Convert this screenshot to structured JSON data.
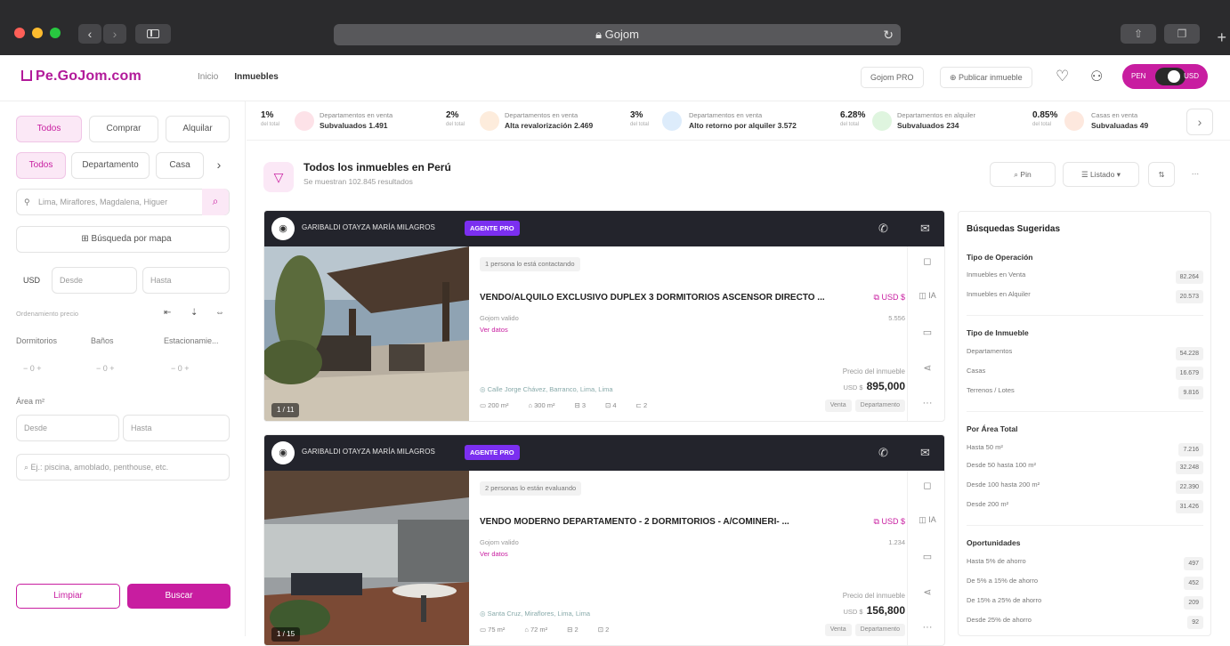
{
  "browser": {
    "url_text": "Gojom",
    "colors": {
      "close": "#ff5f57",
      "minimize": "#febc2e",
      "zoom": "#28c840"
    }
  },
  "header": {
    "logo": "Pe.GoJom.com",
    "nav": [
      "Inicio",
      "Inmuebles"
    ],
    "btn_pro": "Gojom PRO",
    "btn_publish": "Publicar inmueble",
    "toggle_left": "PEN",
    "toggle_right": "USD"
  },
  "sidebar": {
    "ops": [
      "Todos",
      "Comprar",
      "Alquilar"
    ],
    "types": [
      "Todos",
      "Departamento",
      "Casa"
    ],
    "location_placeholder": "Lima, Miraflores, Magdalena, Higuer",
    "map_search": "Búsqueda por mapa",
    "currency": "USD",
    "price_from": "Desde",
    "price_to": "Hasta",
    "order_label": "Ordenamiento precio",
    "rooms": [
      "Dormitorios",
      "Baños",
      "Estacionamie..."
    ],
    "area_label": "Área m²",
    "area_from": "Desde",
    "area_to": "Hasta",
    "keywords_placeholder": "Ej.: piscina, amoblado, penthouse, etc.",
    "clear_btn": "Limpiar",
    "search_btn": "Buscar"
  },
  "stats": [
    {
      "pct": "1%",
      "sub": "del total",
      "line1": "Departamentos en venta",
      "line2": "Subvaluados 1.491",
      "color": "#fde2e8"
    },
    {
      "pct": "2%",
      "sub": "del total",
      "line1": "Departamentos en venta",
      "line2": "Alta revalorización 2.469",
      "color": "#fdecdc"
    },
    {
      "pct": "3%",
      "sub": "del total",
      "line1": "Departamentos en venta",
      "line2": "Alto retorno por alquiler 3.572",
      "color": "#ddecfb"
    },
    {
      "pct": "6.28%",
      "sub": "del total",
      "line1": "Departamentos en alquiler",
      "line2": "Subvaluados 234",
      "color": "#dff5df"
    },
    {
      "pct": "0.85%",
      "sub": "del total",
      "line1": "Casas en venta",
      "line2": "Subvaluadas 49",
      "color": "#fde8de"
    }
  ],
  "results": {
    "title": "Todos los inmuebles en Perú",
    "subtitle": "Se muestran 102.845 resultados",
    "pin_btn": "Pin",
    "list_btn": "Listado"
  },
  "cards": [
    {
      "agent": "GARIBALDI OTAYZA MARÍA MILAGROS",
      "pro": "AGENTE PRO",
      "chip": "1 persona lo está contactando",
      "title": "VENDO/ALQUILO EXCLUSIVO DUPLEX 3 DORMITORIOS ASCENSOR DIRECTO ...",
      "currency": "USD $",
      "line1": "Gojom valido",
      "line2": "Ver datos",
      "right_small": "5.556",
      "price_label": "Precio del inmueble",
      "price_pre": "USD $",
      "price": "895,000",
      "address": "Calle Jorge Chávez, Barranco, Lima, Lima",
      "feats": [
        "200 m²",
        "300 m²",
        "3",
        "4",
        "2"
      ],
      "tags": [
        "Venta",
        "Departamento"
      ],
      "photos": "1 / 11"
    },
    {
      "agent": "GARIBALDI OTAYZA MARÍA MILAGROS",
      "pro": "AGENTE PRO",
      "chip": "2 personas lo están evaluando",
      "title": "VENDO MODERNO DEPARTAMENTO - 2 DORMITORIOS - A/COMINERI- ...",
      "currency": "USD $",
      "line1": "Gojom valido",
      "line2": "Ver datos",
      "right_small": "1.234",
      "price_label": "Precio del inmueble",
      "price_pre": "USD $",
      "price": "156,800",
      "address": "Santa Cruz, Miraflores, Lima, Lima",
      "feats": [
        "75 m²",
        "72 m²",
        "2",
        "2"
      ],
      "tags": [
        "Venta",
        "Departamento"
      ],
      "photos": "1 / 15"
    }
  ],
  "suggestions": {
    "title": "Búsquedas Sugeridas",
    "groups": [
      {
        "name": "Tipo de Operación",
        "rows": [
          [
            "Inmuebles en Venta",
            "82.264"
          ],
          [
            "Inmuebles en Alquiler",
            "20.573"
          ]
        ]
      },
      {
        "name": "Tipo de Inmueble",
        "rows": [
          [
            "Departamentos",
            "54.228"
          ],
          [
            "Casas",
            "16.679"
          ],
          [
            "Terrenos / Lotes",
            "9.816"
          ]
        ]
      },
      {
        "name": "Por Área Total",
        "rows": [
          [
            "Hasta 50 m²",
            "7.216"
          ],
          [
            "Desde 50 hasta 100 m²",
            "32.248"
          ],
          [
            "Desde 100 hasta 200 m²",
            "22.390"
          ],
          [
            "Desde 200 m²",
            "31.426"
          ]
        ]
      },
      {
        "name": "Oportunidades",
        "rows": [
          [
            "Hasta 5% de ahorro",
            "497"
          ],
          [
            "De 5% a 15% de ahorro",
            "452"
          ],
          [
            "De 15% a 25% de ahorro",
            "209"
          ],
          [
            "Desde 25% de ahorro",
            "92"
          ]
        ]
      }
    ]
  }
}
